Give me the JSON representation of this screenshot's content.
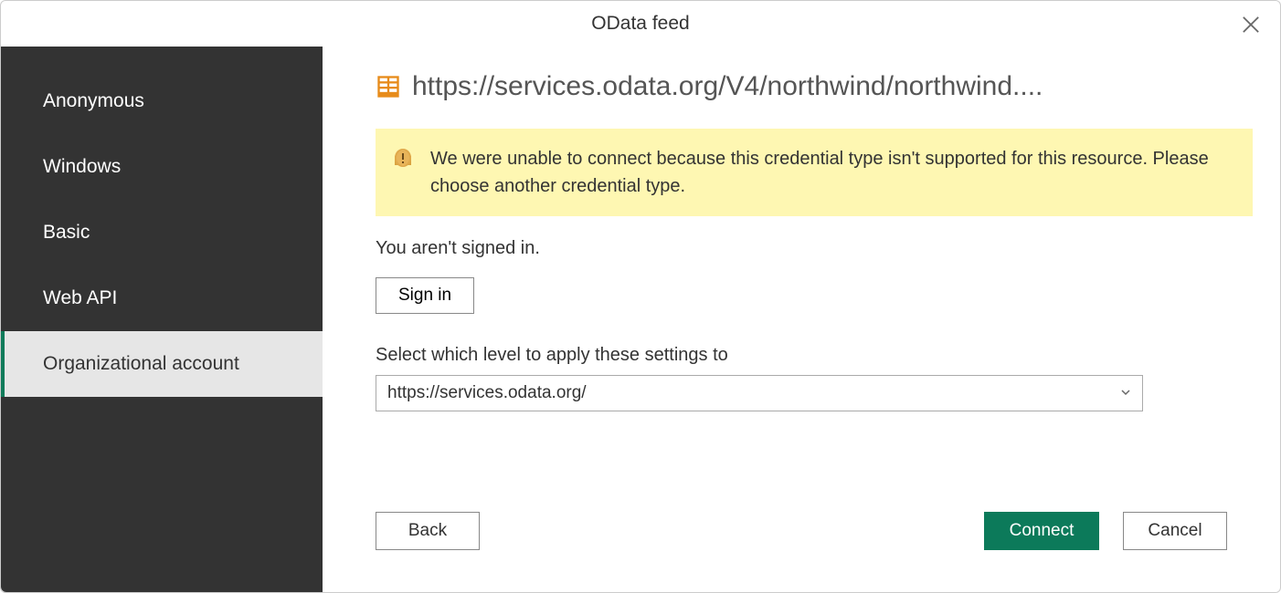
{
  "header": {
    "title": "OData feed"
  },
  "sidebar": {
    "items": [
      {
        "label": "Anonymous",
        "selected": false
      },
      {
        "label": "Windows",
        "selected": false
      },
      {
        "label": "Basic",
        "selected": false
      },
      {
        "label": "Web API",
        "selected": false
      },
      {
        "label": "Organizational account",
        "selected": true
      }
    ]
  },
  "main": {
    "url": "https://services.odata.org/V4/northwind/northwind....",
    "warning": "We were unable to connect because this credential type isn't supported for this resource. Please choose another credential type.",
    "signin_status": "You aren't signed in.",
    "signin_label": "Sign in",
    "level_label": "Select which level to apply these settings to",
    "level_value": "https://services.odata.org/"
  },
  "footer": {
    "back": "Back",
    "connect": "Connect",
    "cancel": "Cancel"
  },
  "colors": {
    "accent": "#0c7a5a",
    "sidebar_bg": "#333333",
    "warning_bg": "#fef7b2"
  }
}
